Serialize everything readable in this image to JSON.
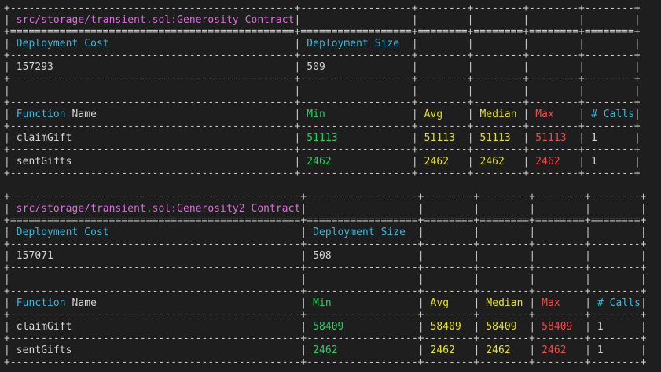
{
  "reports": [
    {
      "title": "src/storage/transient.sol:Generosity Contract",
      "deployment": {
        "cost_label": "Deployment Cost",
        "size_label": "Deployment Size",
        "cost": "157293",
        "size": "509"
      },
      "headers": {
        "function_word": "Function",
        "name_word": "Name",
        "min": "Min",
        "avg": "Avg",
        "median": "Median",
        "max": "Max",
        "calls": "# Calls"
      },
      "rows": [
        {
          "fn": "claimGift",
          "min": "51113",
          "avg": "51113",
          "median": "51113",
          "max": "51113",
          "calls": "1"
        },
        {
          "fn": "sentGifts",
          "min": "2462",
          "avg": "2462",
          "median": "2462",
          "max": "2462",
          "calls": "1"
        }
      ]
    },
    {
      "title": "src/storage/transient.sol:Generosity2 Contract",
      "deployment": {
        "cost_label": "Deployment Cost",
        "size_label": "Deployment Size",
        "cost": "157071",
        "size": "508"
      },
      "headers": {
        "function_word": "Function",
        "name_word": "Name",
        "min": "Min",
        "avg": "Avg",
        "median": "Median",
        "max": "Max",
        "calls": "# Calls"
      },
      "rows": [
        {
          "fn": "claimGift",
          "min": "58409",
          "avg": "58409",
          "median": "58409",
          "max": "58409",
          "calls": "1"
        },
        {
          "fn": "sentGifts",
          "min": "2462",
          "avg": "2462",
          "median": "2462",
          "max": "2462",
          "calls": "1"
        }
      ]
    }
  ]
}
